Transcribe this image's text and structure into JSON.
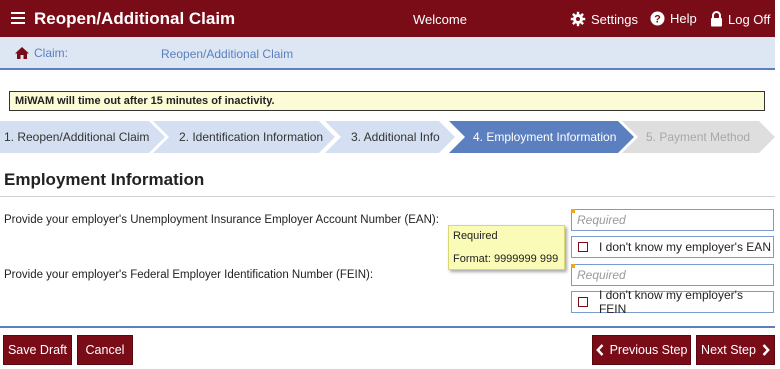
{
  "header": {
    "app_title": "Reopen/Additional Claim",
    "welcome": "Welcome",
    "settings": "Settings",
    "help": "Help",
    "logoff": "Log Off",
    "bar_color": "#7a0c18"
  },
  "breadcrumb": {
    "root": "Claim:",
    "current": "Reopen/Additional Claim"
  },
  "notice": "MiWAM will time out after 15 minutes of inactivity.",
  "steps": [
    {
      "label": "1. Reopen/Additional Claim",
      "state": "done"
    },
    {
      "label": "2. Identification Information",
      "state": "done"
    },
    {
      "label": "3. Additional Info",
      "state": "done"
    },
    {
      "label": "4. Employment Information",
      "state": "active"
    },
    {
      "label": "5. Payment Method",
      "state": "todo"
    }
  ],
  "section_title": "Employment Information",
  "fields": {
    "ean": {
      "label": "Provide your employer's Unemployment Insurance Employer Account Number (EAN):",
      "placeholder": "Required",
      "checkbox_label": "I don't know my employer's EAN"
    },
    "fein": {
      "label": "Provide your employer's Federal Employer Identification Number (FEIN):",
      "placeholder": "Required",
      "checkbox_label": "I don't know my employer's FEIN"
    }
  },
  "tooltip": {
    "line1": "Required",
    "line2": "Format: 9999999 999"
  },
  "buttons": {
    "save_draft": "Save Draft",
    "cancel": "Cancel",
    "previous": "Previous Step",
    "next": "Next Step"
  },
  "icons": {
    "menu": "hamburger-icon",
    "settings": "gear-icon",
    "help": "question-circle-icon",
    "logoff": "padlock-icon",
    "home": "home-icon",
    "previous": "chevron-left-icon",
    "next": "chevron-right-icon"
  },
  "colors": {
    "accent_blue": "#5b7fbf",
    "required_marker": "#f0a818"
  }
}
